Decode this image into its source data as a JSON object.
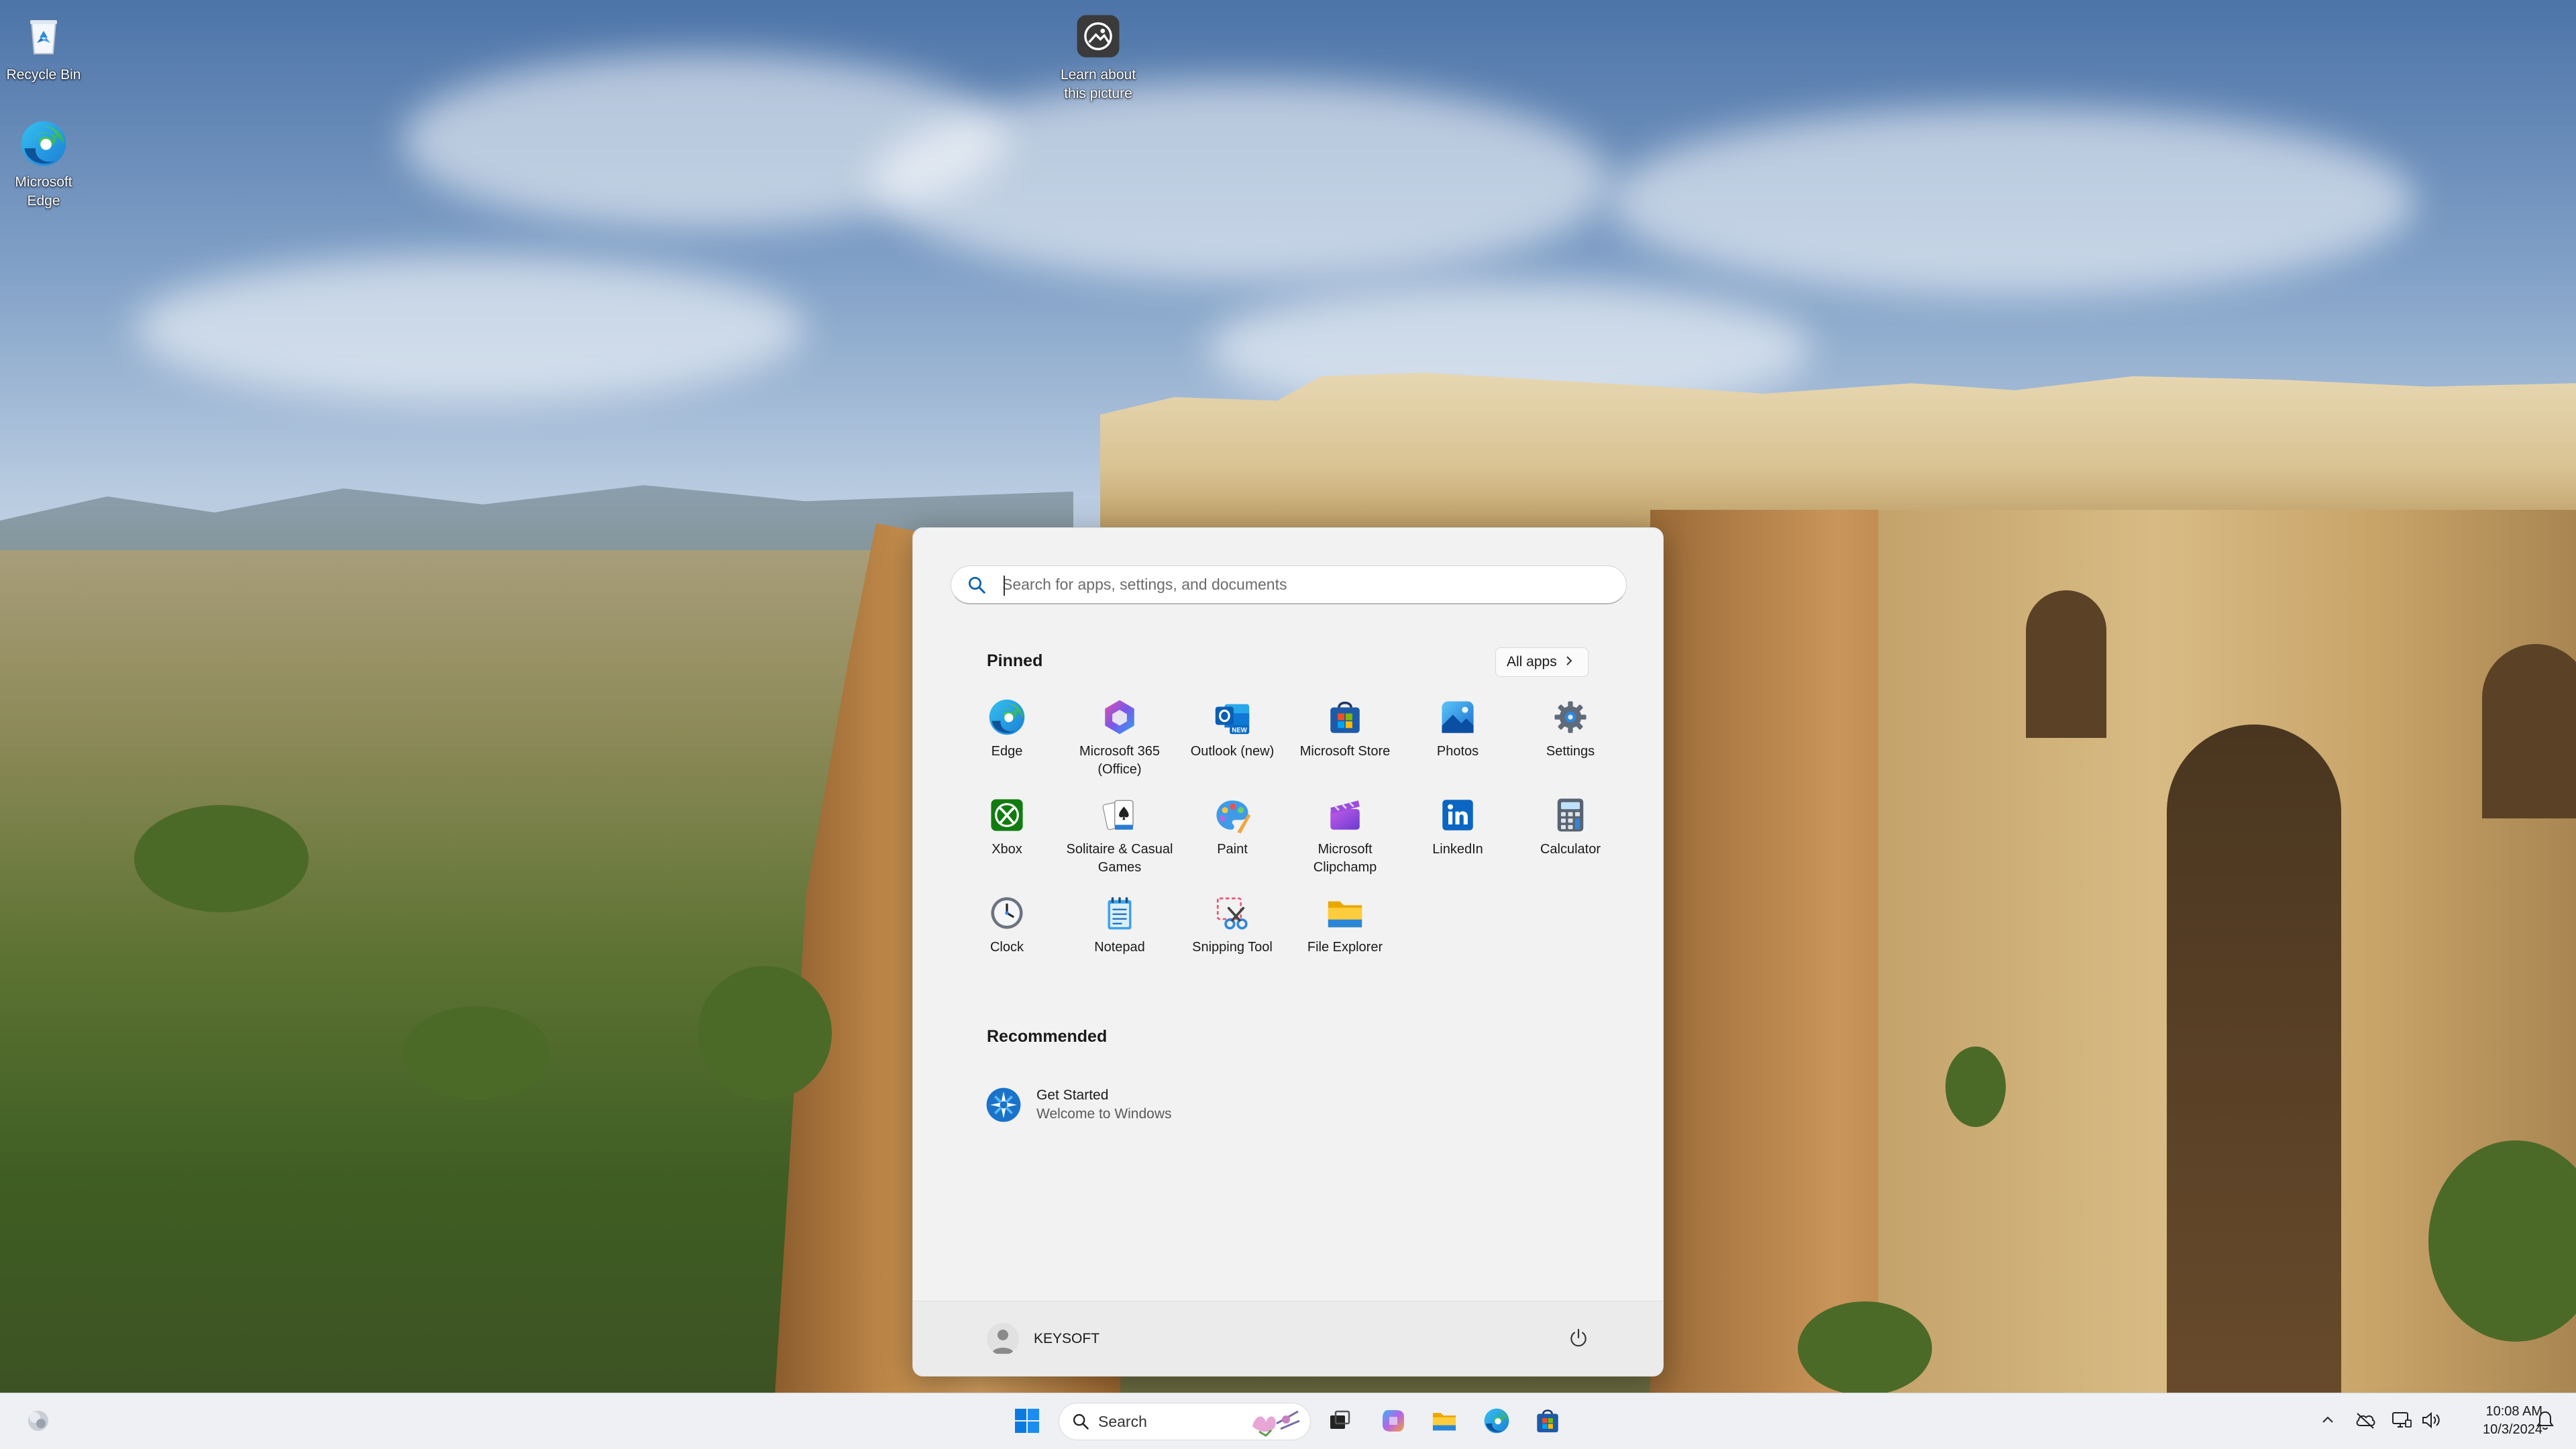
{
  "desktop": {
    "icons": [
      {
        "label": "Recycle Bin"
      },
      {
        "label": "Microsoft Edge"
      },
      {
        "label": "Learn about this picture"
      }
    ]
  },
  "start_menu": {
    "search": {
      "placeholder": "Search for apps, settings, and documents",
      "value": ""
    },
    "pinned": {
      "title": "Pinned",
      "all_apps_label": "All apps",
      "apps": [
        {
          "label": "Edge",
          "icon": "edge-icon"
        },
        {
          "label": "Microsoft 365 (Office)",
          "icon": "microsoft-365-icon"
        },
        {
          "label": "Outlook (new)",
          "icon": "outlook-icon"
        },
        {
          "label": "Microsoft Store",
          "icon": "store-icon"
        },
        {
          "label": "Photos",
          "icon": "photos-icon"
        },
        {
          "label": "Settings",
          "icon": "settings-icon"
        },
        {
          "label": "Xbox",
          "icon": "xbox-icon"
        },
        {
          "label": "Solitaire & Casual Games",
          "icon": "solitaire-icon"
        },
        {
          "label": "Paint",
          "icon": "paint-icon"
        },
        {
          "label": "Microsoft Clipchamp",
          "icon": "clipchamp-icon"
        },
        {
          "label": "LinkedIn",
          "icon": "linkedin-icon"
        },
        {
          "label": "Calculator",
          "icon": "calculator-icon"
        },
        {
          "label": "Clock",
          "icon": "clock-icon"
        },
        {
          "label": "Notepad",
          "icon": "notepad-icon"
        },
        {
          "label": "Snipping Tool",
          "icon": "snipping-tool-icon"
        },
        {
          "label": "File Explorer",
          "icon": "file-explorer-icon"
        }
      ],
      "new_badge": "NEW"
    },
    "recommended": {
      "title": "Recommended",
      "items": [
        {
          "title": "Get Started",
          "subtitle": "Welcome to Windows",
          "icon": "get-started-icon"
        }
      ]
    },
    "user": {
      "name": "KEYSOFT"
    }
  },
  "taskbar": {
    "search_label": "Search",
    "clock": {
      "time": "10:08 AM",
      "date": "10/3/2024"
    }
  },
  "colors": {
    "start_bg": "#f2f2f2",
    "accent_blue": "#0078d4",
    "taskbar_bg": "#eef0f3"
  }
}
